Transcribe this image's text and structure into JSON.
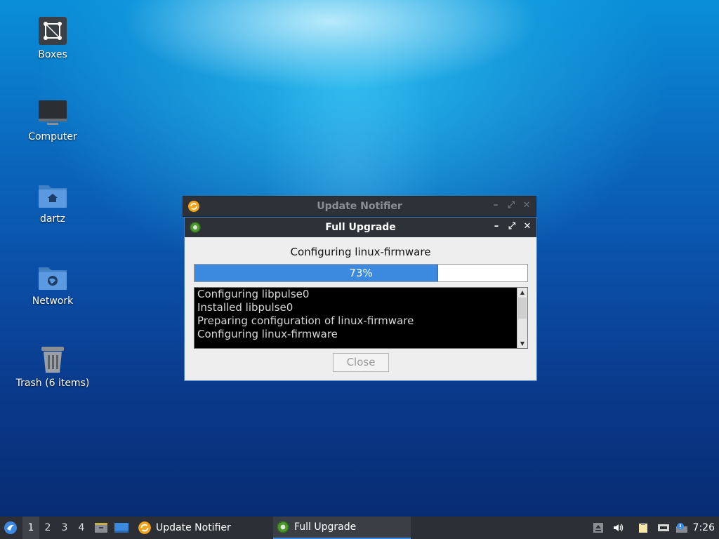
{
  "desktop": {
    "icons": [
      {
        "label": "Boxes"
      },
      {
        "label": "Computer"
      },
      {
        "label": "dartz"
      },
      {
        "label": "Network"
      },
      {
        "label": "Trash (6 items)"
      }
    ]
  },
  "update_notifier_window": {
    "title": "Update Notifier"
  },
  "full_upgrade_window": {
    "title": "Full Upgrade",
    "status": "Configuring linux-firmware",
    "progress": {
      "percent": 73,
      "label": "73%"
    },
    "log_lines": [
      "Configuring libpulse0",
      "Installed libpulse0",
      "Preparing configuration of linux-firmware",
      "Configuring linux-firmware"
    ],
    "close_label": "Close"
  },
  "taskbar": {
    "workspaces": [
      "1",
      "2",
      "3",
      "4"
    ],
    "active_workspace": "1",
    "tasks": [
      {
        "label": "Update Notifier"
      },
      {
        "label": "Full Upgrade"
      }
    ],
    "clock": "7:26"
  },
  "colors": {
    "accent": "#3b8ae0",
    "titlebar": "#2d3238",
    "taskbar": "#2c3036"
  }
}
